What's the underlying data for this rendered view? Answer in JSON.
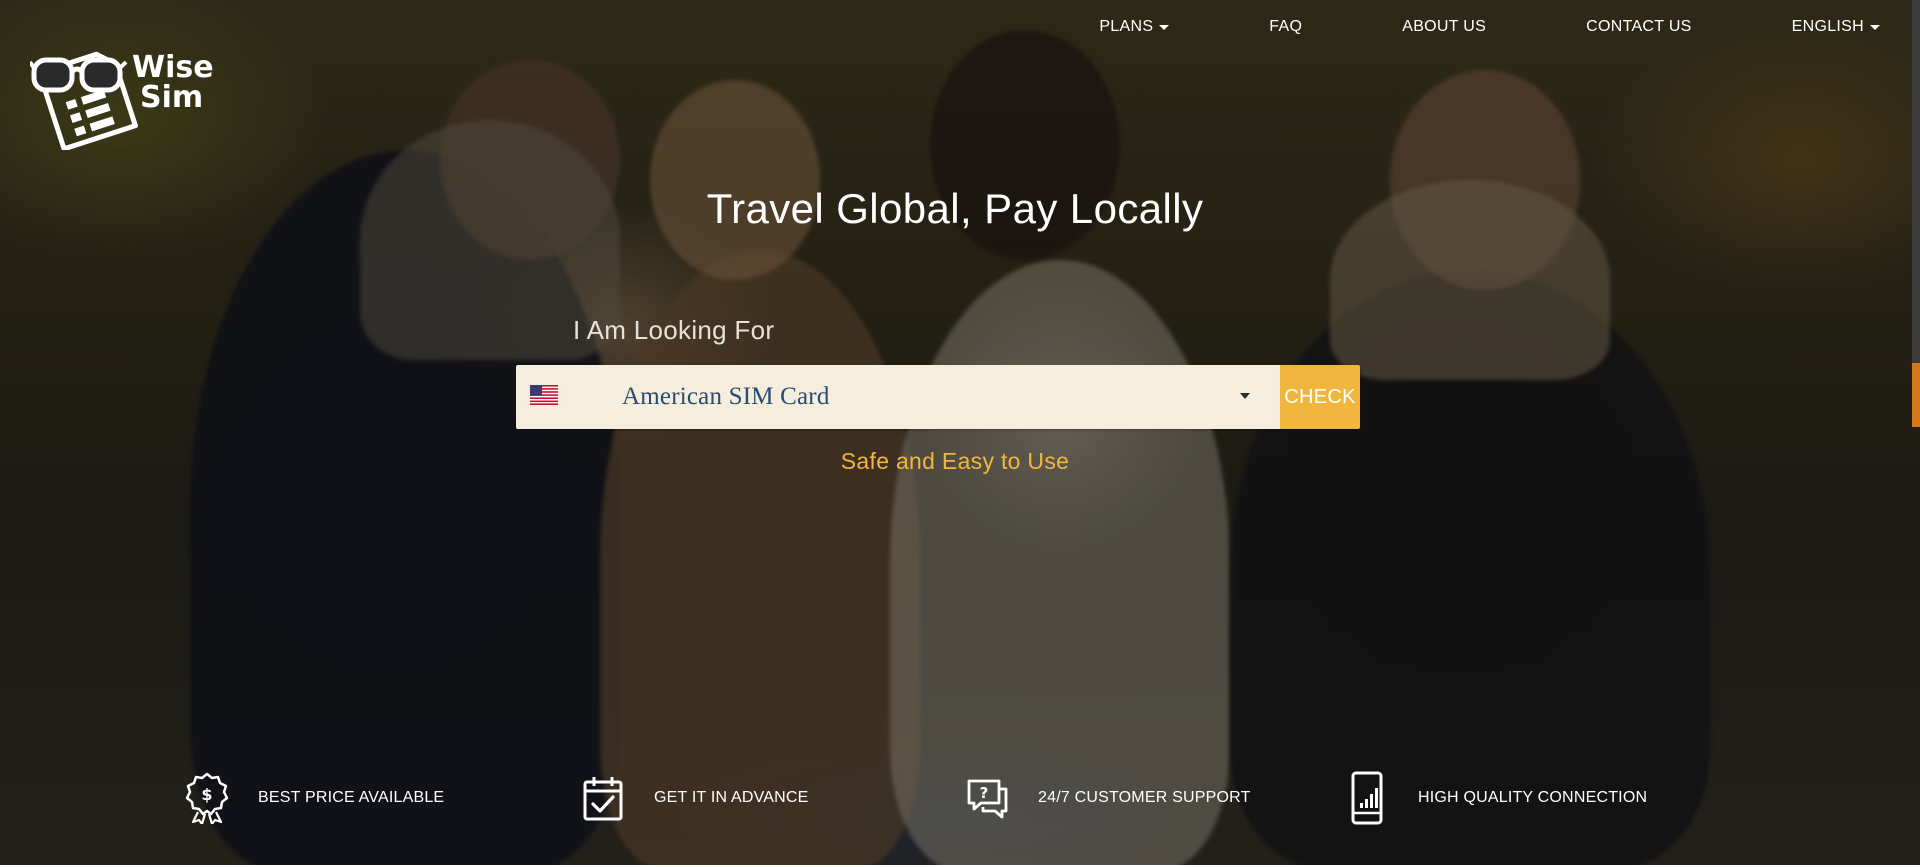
{
  "brand": {
    "logo_icon": "glasses-sim-card-logo",
    "logo_line1": "Wise",
    "logo_line2": "Sim"
  },
  "nav": {
    "items": [
      {
        "label": "PLANS",
        "has_dropdown": true
      },
      {
        "label": "FAQ",
        "has_dropdown": false
      },
      {
        "label": "ABOUT US",
        "has_dropdown": false
      },
      {
        "label": "CONTACT US",
        "has_dropdown": false
      },
      {
        "label": "ENGLISH",
        "has_dropdown": true
      }
    ]
  },
  "hero": {
    "title": "Travel Global, Pay Locally",
    "looking_label": "I Am Looking For",
    "search": {
      "flag_icon": "us-flag-icon",
      "selected_value": "American SIM Card",
      "check_label": "CHECK"
    },
    "tagline": "Safe and Easy to Use"
  },
  "features": [
    {
      "icon": "price-badge-icon",
      "label": "BEST PRICE AVAILABLE"
    },
    {
      "icon": "calendar-check-icon",
      "label": "GET IT IN ADVANCE"
    },
    {
      "icon": "chat-question-icon",
      "label": "24/7 CUSTOMER SUPPORT"
    },
    {
      "icon": "phone-signal-icon",
      "label": "HIGH QUALITY CONNECTION"
    }
  ],
  "colors": {
    "accent": "#f0b63d",
    "select_bg": "#f5eedf",
    "select_text": "#2a4a6e",
    "text_light": "#ffffff",
    "scroll_indicator": "#d4781c"
  }
}
